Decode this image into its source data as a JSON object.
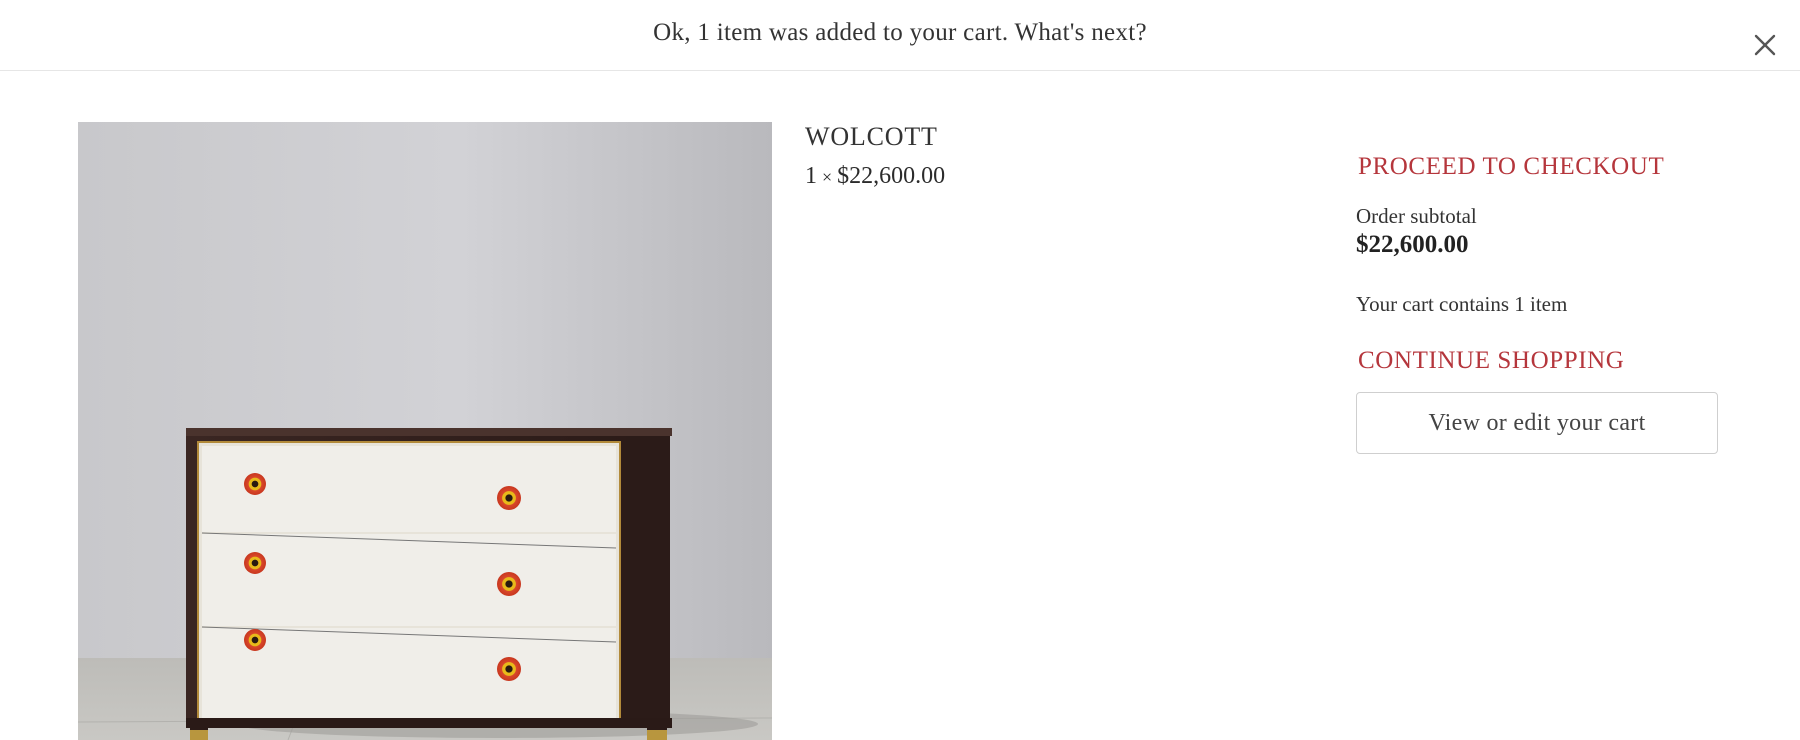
{
  "notification": {
    "message": "Ok, 1 item was added to your cart. What's next?",
    "close_icon": "close-icon"
  },
  "product": {
    "name": "WOLCOTT",
    "quantity": "1",
    "times_symbol": "×",
    "price": "$22,600.00",
    "image_icon": "dresser-image"
  },
  "cart": {
    "checkout_label": "PROCEED TO CHECKOUT",
    "subtotal_label": "Order subtotal",
    "subtotal_value": "$22,600.00",
    "count_text": "Your cart contains 1 item",
    "continue_label": "CONTINUE SHOPPING",
    "view_cart_label": "View or edit your cart"
  },
  "colors": {
    "accent_red": "#b5363c",
    "border": "#cfcfcf"
  }
}
